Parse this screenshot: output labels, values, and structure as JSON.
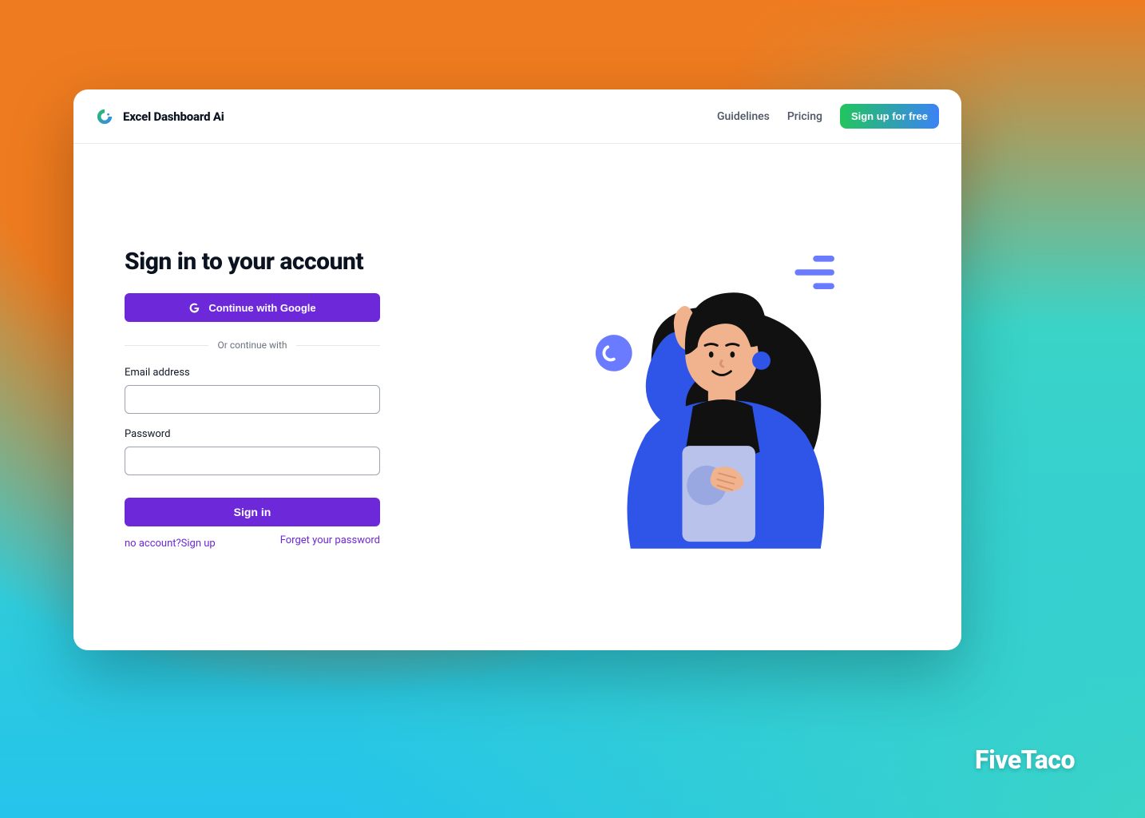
{
  "brand": {
    "name": "Excel Dashboard Ai",
    "colors": {
      "accent1": "#22c55e",
      "accent2": "#3b82f6",
      "primary": "#6d28d9"
    }
  },
  "nav": {
    "guidelines": "Guidelines",
    "pricing": "Pricing",
    "cta": "Sign up for free"
  },
  "signin": {
    "heading": "Sign in to your account",
    "google_label": "Continue with Google",
    "divider": "Or continue with",
    "email_label": "Email address",
    "email_value": "",
    "password_label": "Password",
    "password_value": "",
    "submit_label": "Sign in",
    "signup_prefix": "no account?",
    "signup_label": "Sign up",
    "forgot_label": "Forget your password"
  },
  "watermark": "FiveTaco"
}
